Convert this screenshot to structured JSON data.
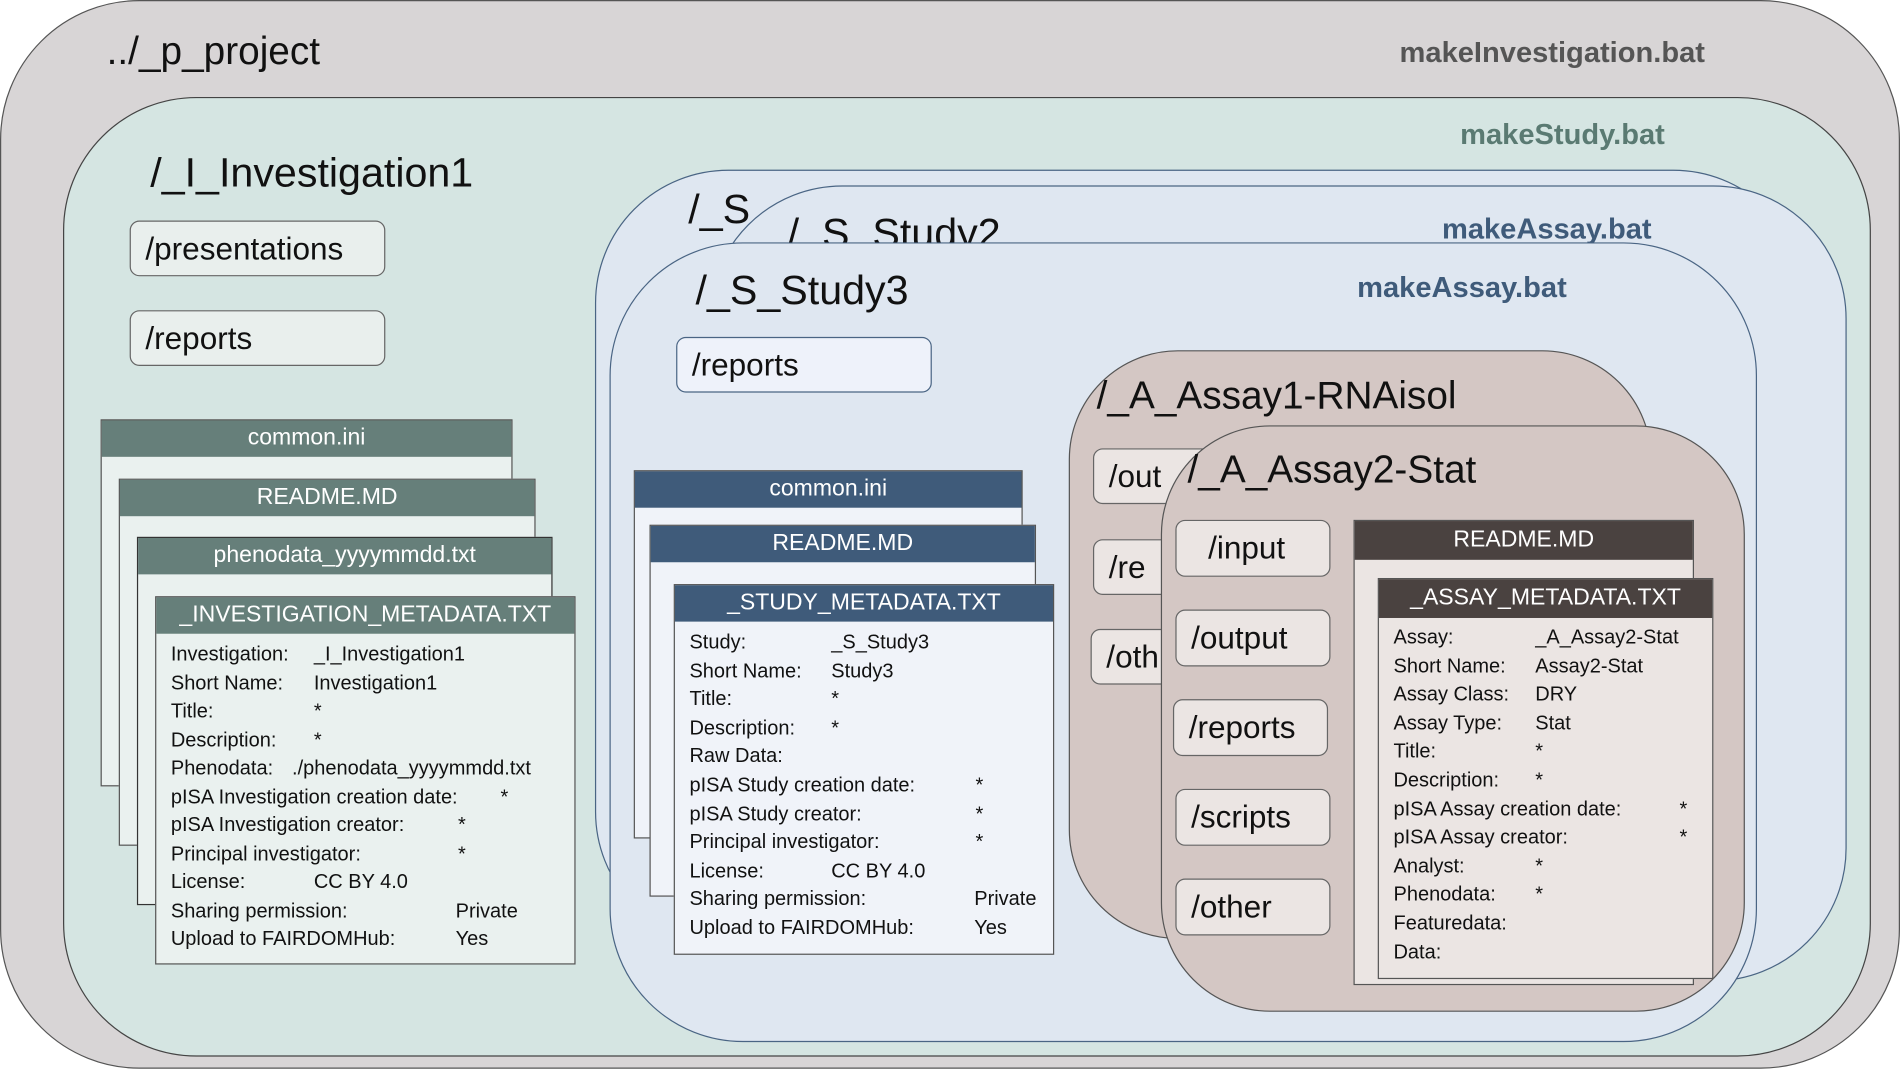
{
  "project": {
    "title": "../_p_project",
    "script": "makeInvestigation.bat"
  },
  "investigation": {
    "title": "/_I_Investigation1",
    "script": "makeStudy.bat",
    "folders": [
      "/presentations",
      "/reports"
    ],
    "files": [
      "common.ini",
      "README.MD",
      "phenodata_yyyymmdd.txt"
    ],
    "metadata": {
      "filename": "_INVESTIGATION_METADATA.TXT",
      "rows": [
        [
          "Investigation:",
          "_I_Investigation1"
        ],
        [
          "Short Name:",
          "Investigation1"
        ],
        [
          "Title:",
          "*"
        ],
        [
          "Description:",
          "*"
        ],
        [
          "Phenodata:",
          "./phenodata_yyyymmdd.txt"
        ],
        [
          "pISA Investigation creation date:",
          "*"
        ],
        [
          "pISA Investigation creator:",
          "*"
        ],
        [
          "Principal investigator:",
          "*"
        ],
        [
          "License:",
          "CC BY 4.0"
        ],
        [
          "Sharing permission:",
          "Private"
        ],
        [
          "Upload to FAIRDOMHub:",
          "Yes"
        ]
      ]
    }
  },
  "studies": [
    {
      "title": "/_S"
    },
    {
      "title": "/_S_Study2",
      "script": "makeAssay.bat"
    },
    {
      "title": "/_S_Study3",
      "script": "makeAssay.bat",
      "folders": [
        "/reports"
      ],
      "files": [
        "common.ini",
        "README.MD"
      ],
      "metadata": {
        "filename": "_STUDY_METADATA.TXT",
        "rows": [
          [
            "Study:",
            "_S_Study3"
          ],
          [
            "Short Name:",
            "Study3"
          ],
          [
            "Title:",
            "*"
          ],
          [
            "Description:",
            "*"
          ],
          [
            "Raw Data:",
            ""
          ],
          [
            "pISA Study creation date:",
            "*"
          ],
          [
            "pISA Study creator:",
            "*"
          ],
          [
            "Principal investigator:",
            "*"
          ],
          [
            "License:",
            "CC BY 4.0"
          ],
          [
            "Sharing permission:",
            "Private"
          ],
          [
            "Upload to FAIRDOMHub:",
            "Yes"
          ]
        ]
      }
    }
  ],
  "assays": [
    {
      "title": "/_A_Assay1-RNAisol",
      "folders": [
        "/out",
        "/re",
        "/oth"
      ]
    },
    {
      "title": "/_A_Assay2-Stat",
      "folders": [
        "/input",
        "/output",
        "/reports",
        "/scripts",
        "/other"
      ],
      "files": [
        "README.MD"
      ],
      "metadata": {
        "filename": "_ASSAY_METADATA.TXT",
        "rows": [
          [
            "Assay:",
            "_A_Assay2-Stat"
          ],
          [
            "Short Name:",
            "Assay2-Stat"
          ],
          [
            "Assay Class:",
            "DRY"
          ],
          [
            "Assay Type:",
            "Stat"
          ],
          [
            "Title:",
            "*"
          ],
          [
            "Description:",
            "*"
          ],
          [
            "pISA Assay creation date:",
            "*"
          ],
          [
            "pISA Assay creator:",
            "*"
          ],
          [
            "Analyst:",
            "*"
          ],
          [
            "Phenodata:",
            "*"
          ],
          [
            "Featuredata:",
            ""
          ],
          [
            "Data:",
            ""
          ]
        ]
      }
    }
  ],
  "colors": {
    "project_bg": "#d8d5d6",
    "investigation_bg": "#d5e5e2",
    "investigation_header": "#667f7a",
    "study_bg": "#dfe7f1",
    "study_header": "#3f5b7a",
    "assay_bg": "#d4c7c4",
    "assay_header": "#4a4240"
  }
}
